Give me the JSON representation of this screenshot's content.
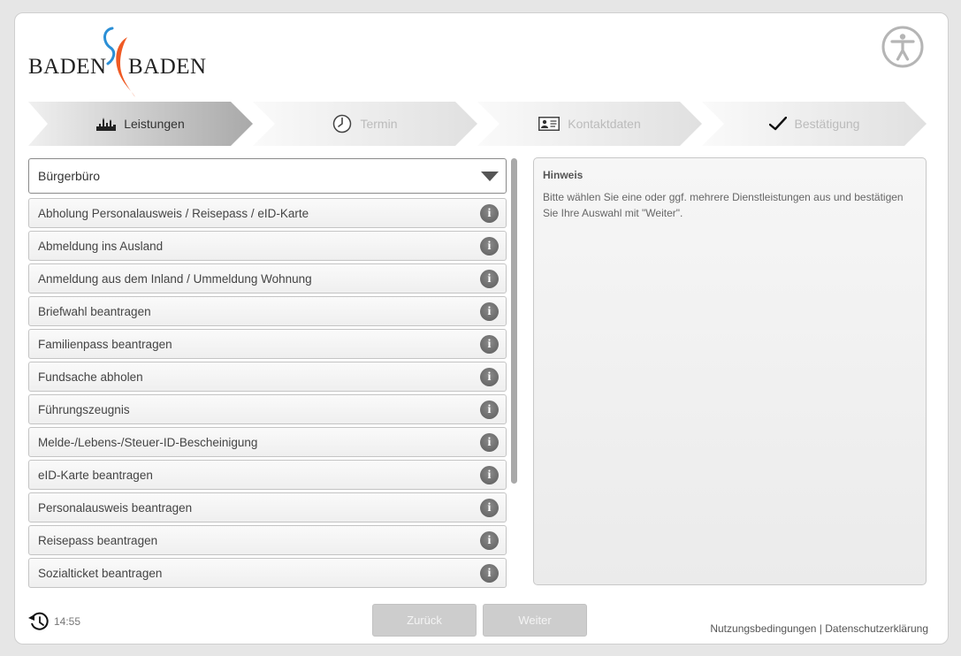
{
  "header": {
    "logo_left": "BADEN",
    "logo_right": "BADEN",
    "accessibility_icon": "accessibility-icon"
  },
  "steps": [
    {
      "label": "Leistungen",
      "icon": "city-skyline-icon",
      "active": true
    },
    {
      "label": "Termin",
      "icon": "clock-icon",
      "active": false
    },
    {
      "label": "Kontaktdaten",
      "icon": "id-card-icon",
      "active": false
    },
    {
      "label": "Bestätigung",
      "icon": "checkmark-icon",
      "active": false
    }
  ],
  "dropdown": {
    "selected": "Bürgerbüro"
  },
  "services": [
    "Abholung Personalausweis / Reisepass / eID-Karte",
    "Abmeldung ins Ausland",
    "Anmeldung aus dem Inland / Ummeldung Wohnung",
    "Briefwahl beantragen",
    "Familienpass beantragen",
    "Fundsache abholen",
    "Führungszeugnis",
    "Melde-/Lebens-/Steuer-ID-Bescheinigung",
    "eID-Karte beantragen",
    "Personalausweis beantragen",
    "Reisepass beantragen",
    "Sozialticket beantragen"
  ],
  "hint": {
    "title": "Hinweis",
    "text": "Bitte wählen Sie eine oder ggf. mehrere Dienstleistungen aus und bestätigen Sie Ihre Auswahl mit \"Weiter\"."
  },
  "footer": {
    "time": "14:55",
    "back_label": "Zurück",
    "next_label": "Weiter",
    "terms_label": "Nutzungsbedingungen",
    "separator": "|",
    "privacy_label": "Datenschutzerklärung"
  },
  "colors": {
    "logo_blue": "#2b8fd6",
    "logo_orange": "#ef5a24"
  }
}
